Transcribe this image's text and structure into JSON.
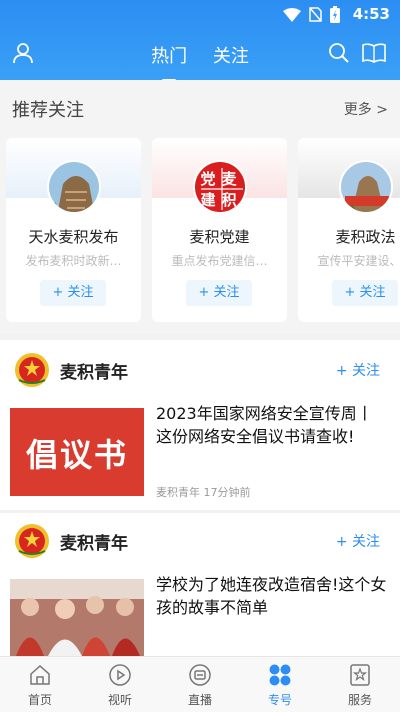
{
  "status": {
    "time": "4:53"
  },
  "nav": {
    "tabs": [
      "热门",
      "关注"
    ]
  },
  "recommend": {
    "title": "推荐关注",
    "more": "更多 >",
    "cards": [
      {
        "name": "天水麦积发布",
        "desc": "发布麦积时政新…",
        "follow": "+ 关注"
      },
      {
        "name": "麦积党建",
        "desc": "重点发布党建信…",
        "follow": "+ 关注",
        "badge": "党麦建积"
      },
      {
        "name": "麦积政法",
        "desc": "宣传平安建设、…",
        "follow": "+ 关注"
      }
    ]
  },
  "feeds": [
    {
      "account": "麦积青年",
      "follow": "+ 关注",
      "headline": "2023年国家网络安全宣传周丨这份网络安全倡议书请查收!",
      "thumb_text": "倡议书",
      "meta": "麦积青年  17分钟前"
    },
    {
      "account": "麦积青年",
      "follow": "+ 关注",
      "headline": "学校为了她连夜改造宿舍!这个女孩的故事不简单"
    }
  ],
  "bottom_nav": [
    {
      "label": "首页",
      "icon": "home-icon"
    },
    {
      "label": "视听",
      "icon": "play-icon"
    },
    {
      "label": "直播",
      "icon": "live-icon"
    },
    {
      "label": "专号",
      "icon": "grid-icon",
      "active": true
    },
    {
      "label": "服务",
      "icon": "star-icon"
    }
  ],
  "colors": {
    "accent": "#2c8ef2",
    "header": "#3aa0f6"
  }
}
